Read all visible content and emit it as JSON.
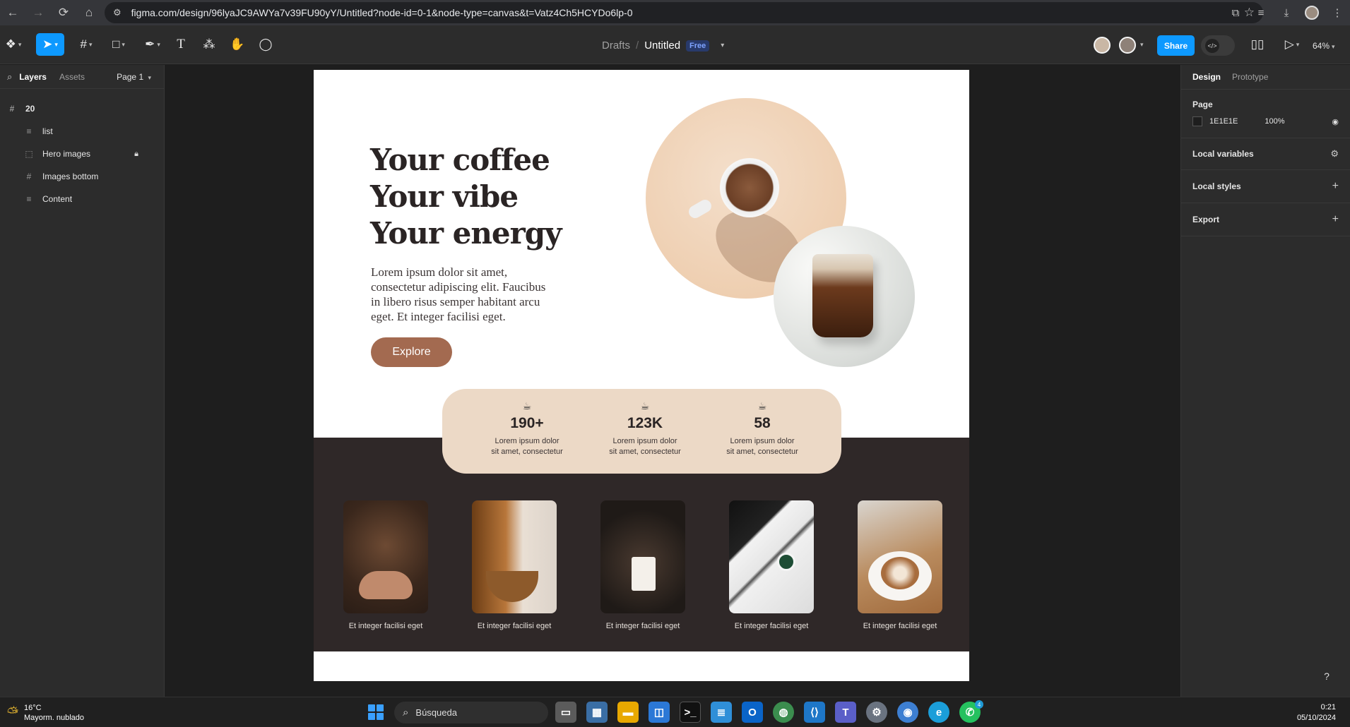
{
  "browser": {
    "url": "figma.com/design/96lyaJC9AWYa7v39FU90yY/Untitled?node-id=0-1&node-type=canvas&t=Vatz4Ch5HCYDo6lp-0"
  },
  "toolbar": {
    "breadcrumb_drafts": "Drafts",
    "breadcrumb_sep": "/",
    "file_title": "Untitled",
    "plan_badge": "Free",
    "share_label": "Share",
    "zoom": "64%"
  },
  "left_panel": {
    "tab_layers": "Layers",
    "tab_assets": "Assets",
    "page_selector": "Page 1",
    "root_frame": "20",
    "layers": [
      {
        "name": "list",
        "icon": "list-icon"
      },
      {
        "name": "Hero images",
        "icon": "frame-dashed-icon",
        "locked": true
      },
      {
        "name": "Images bottom",
        "icon": "frame-icon"
      },
      {
        "name": "Content",
        "icon": "list-icon"
      }
    ]
  },
  "right_panel": {
    "tab_design": "Design",
    "tab_prototype": "Prototype",
    "page_heading": "Page",
    "page_color": "1E1E1E",
    "page_opacity": "100%",
    "local_variables": "Local variables",
    "local_styles": "Local styles",
    "export": "Export"
  },
  "design": {
    "hero_line1": "Your coffee",
    "hero_line2": "Your vibe",
    "hero_line3": "Your energy",
    "description": "Lorem ipsum dolor sit amet, consectetur adipiscing elit. Faucibus in libero risus semper habitant arcu eget. Et integer facilisi eget.",
    "cta": "Explore",
    "stats": [
      {
        "value": "190+",
        "label_line1": "Lorem ipsum dolor",
        "label_line2": "sit amet, consectetur"
      },
      {
        "value": "123K",
        "label_line1": "Lorem ipsum dolor",
        "label_line2": "sit amet, consectetur"
      },
      {
        "value": "58",
        "label_line1": "Lorem ipsum dolor",
        "label_line2": "sit amet, consectetur"
      }
    ],
    "gallery_captions": [
      "Et integer facilisi eget",
      "Et integer facilisi eget",
      "Et integer facilisi eget",
      "Et integer facilisi eget",
      "Et integer facilisi eget"
    ],
    "colors": {
      "accent_brown": "#a36a50",
      "stats_beige": "#ecd9c6",
      "dark_band": "#2f2828"
    }
  },
  "taskbar": {
    "temperature": "16°C",
    "weather": "Mayorm. nublado",
    "search_placeholder": "Búsqueda",
    "time": "0:21",
    "date": "05/10/2024",
    "whatsapp_badge": "4"
  }
}
